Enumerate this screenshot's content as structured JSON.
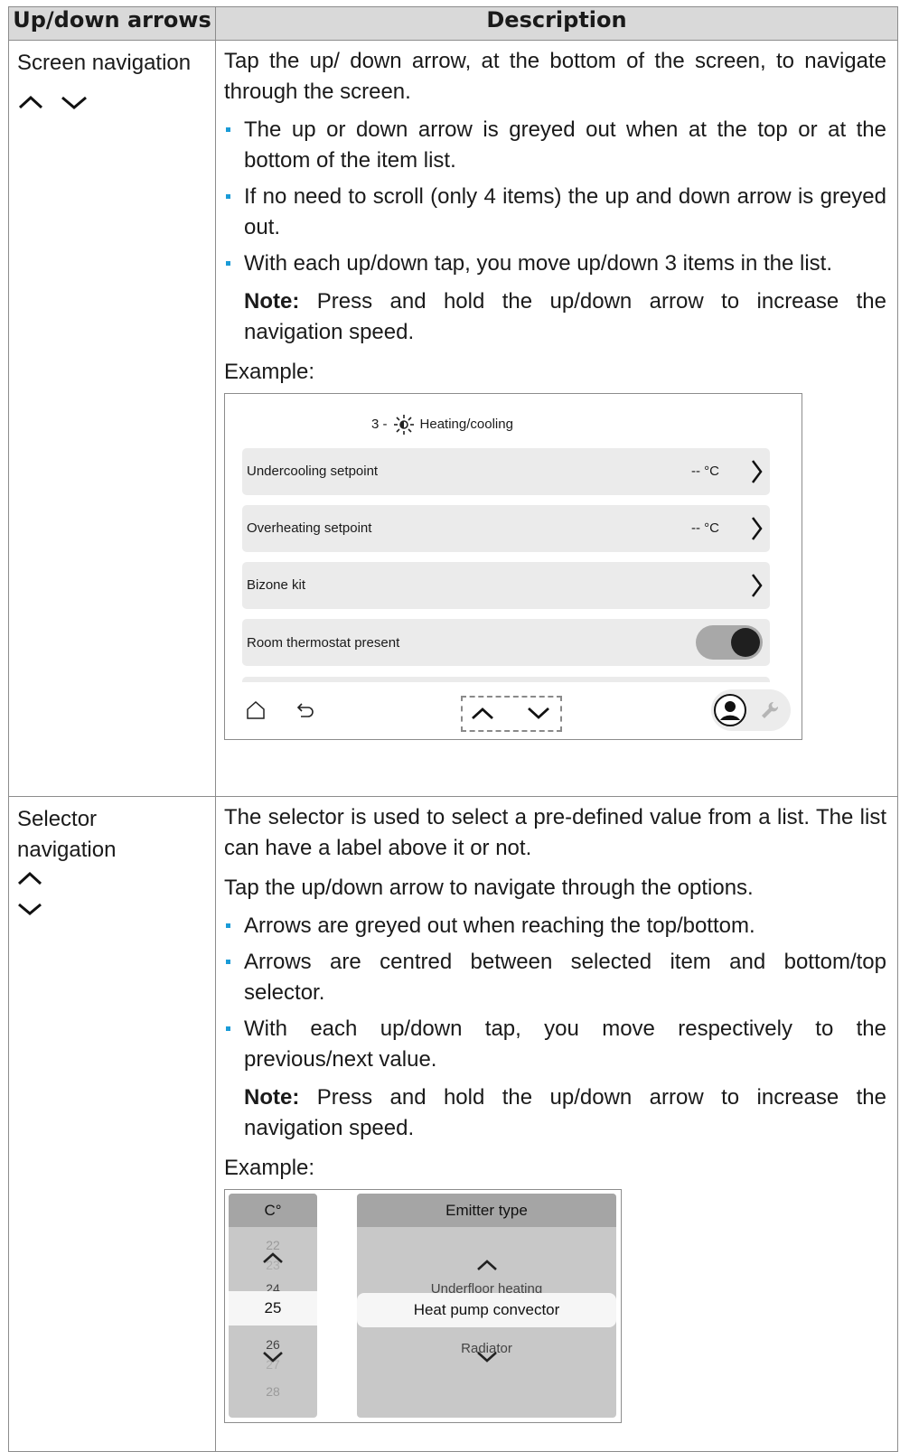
{
  "table": {
    "header_col1": "Up/down arrows",
    "header_col2": "Description"
  },
  "row1": {
    "label": "Screen navigation",
    "intro": "Tap the up/ down arrow, at the bottom of the screen, to navigate through the screen.",
    "bullets": [
      "The up or down arrow is greyed out when at the top or at the bottom of the item list.",
      "If no need to scroll (only 4 items) the up and down arrow is greyed out.",
      "With each up/down tap, you move up/down 3 items in the list."
    ],
    "note_label": "Note:",
    "note_text": " Press and hold the up/down arrow to increase the navigation speed.",
    "example_label": "Example:",
    "example": {
      "title_prefix": "3 -",
      "title": "Heating/cooling",
      "title_icon": "heating-cooling-icon",
      "rows": [
        {
          "label": "Undercooling setpoint",
          "value": "-- °C"
        },
        {
          "label": "Overheating setpoint",
          "value": "-- °C"
        },
        {
          "label": "Bizone kit",
          "value": ""
        },
        {
          "label": "Room thermostat present",
          "value": ""
        }
      ],
      "toggle_on": true,
      "bottom_icons": [
        "home-icon",
        "back-icon",
        "chevron-up-icon",
        "chevron-down-icon",
        "user-icon",
        "wrench-icon"
      ]
    }
  },
  "row2": {
    "label": "Selector navigation",
    "intro": "The selector is used to select a pre-defined value from a list. The list can have a label above it or not.",
    "tap_text": "Tap the up/down arrow to navigate through the options.",
    "bullets": [
      "Arrows are greyed out when reaching the top/bottom.",
      "Arrows are centred between selected item and bottom/top selector.",
      "With each up/down tap, you move respectively to the previous/next value."
    ],
    "note_label": "Note:",
    "note_text": " Press and hold the up/down arrow to increase the navigation speed.",
    "example_label": "Example:",
    "example": {
      "small_header": "C°",
      "small_values": [
        "22",
        "23",
        "24",
        "25",
        "26",
        "27",
        "28"
      ],
      "small_selected": "25",
      "big_header": "Emitter type",
      "big_above": "Underfloor heating",
      "big_selected": "Heat pump convector",
      "big_below": "Radiator"
    }
  },
  "colors": {
    "header_bg": "#d9d9d9",
    "bullet": "#1a9bd7",
    "row_bg": "#ebebeb",
    "selector_bg": "#c8c8c8",
    "selector_head": "#a5a5a5"
  }
}
